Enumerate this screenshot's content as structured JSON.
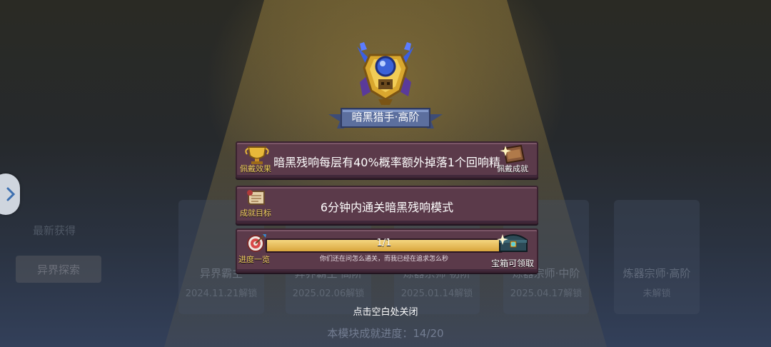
{
  "background": {
    "sidebar_label": "最新获得",
    "sidebar_tab": "异界探索",
    "cards": [
      {
        "title": "异界霸主",
        "date": "2024.11.21解锁"
      },
      {
        "title": "异界霸主·高阶",
        "date": "2025.02.06解锁"
      },
      {
        "title": "炼器宗师·初阶",
        "date": "2025.01.14解锁"
      },
      {
        "title": "炼器宗师·中阶",
        "date": "2025.04.17解锁"
      },
      {
        "title": "炼器宗师·高阶",
        "date": "未解锁"
      }
    ],
    "module_progress": "本模块成就进度：14/20"
  },
  "achievement": {
    "title": "暗黑猎手·高阶",
    "effect_text": "暗黑残响每层有40%概率额外掉落1个回响精",
    "effect_label": "佩戴效果",
    "wear_button_label": "佩戴成就",
    "goal_label": "成就目标",
    "goal_text": "6分钟内通关暗黑残响模式",
    "progress_label": "进度一览",
    "progress_text": "1/1",
    "progress_fraction": 1.0,
    "hint_text": "你们还在问怎么通关，而我已经在追求怎么秒",
    "chest_label": "宝箱可领取"
  },
  "close_hint": "点击空白处关闭",
  "colors": {
    "panel": "#5b3a4a",
    "gold": "#f2d060",
    "ribbon": "#5c6f9e"
  },
  "icons": [
    "trophy-icon",
    "badge-icon",
    "scroll-icon",
    "target-icon",
    "treasure-chest-icon",
    "chevron-right-icon"
  ]
}
